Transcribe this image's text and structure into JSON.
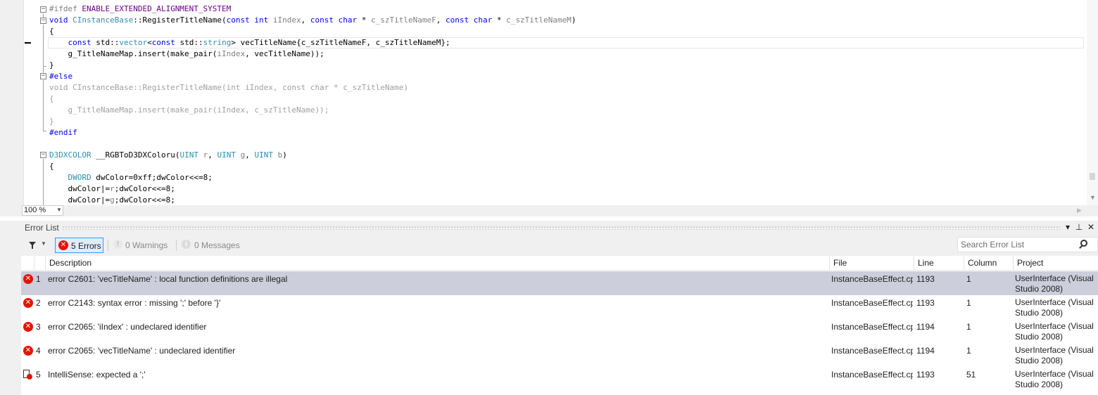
{
  "editor": {
    "code_lines": [
      [
        {
          "t": "#ifdef ",
          "c": "pp"
        },
        {
          "t": "ENABLE_EXTENDED_ALIGNMENT_SYSTEM",
          "c": "mc"
        }
      ],
      [
        {
          "t": "void ",
          "c": "kw"
        },
        {
          "t": "CInstanceBase",
          "c": "ty"
        },
        {
          "t": "::RegisterTitleName(",
          "c": "dk"
        },
        {
          "t": "const int ",
          "c": "kw"
        },
        {
          "t": "iIndex",
          "c": "pa"
        },
        {
          "t": ", ",
          "c": "dk"
        },
        {
          "t": "const char",
          "c": "kw"
        },
        {
          "t": " * ",
          "c": "dk"
        },
        {
          "t": "c_szTitleNameF",
          "c": "pa"
        },
        {
          "t": ", ",
          "c": "dk"
        },
        {
          "t": "const char",
          "c": "kw"
        },
        {
          "t": " * ",
          "c": "dk"
        },
        {
          "t": "c_szTitleNameM",
          "c": "pa"
        },
        {
          "t": ")",
          "c": "dk"
        }
      ],
      [
        {
          "t": "{",
          "c": "dk"
        }
      ],
      [
        {
          "t": "    ",
          "c": "dk"
        },
        {
          "t": "const ",
          "c": "kw"
        },
        {
          "t": "std::",
          "c": "dk"
        },
        {
          "t": "vector",
          "c": "ty"
        },
        {
          "t": "<",
          "c": "dk"
        },
        {
          "t": "const ",
          "c": "kw"
        },
        {
          "t": "std::",
          "c": "dk"
        },
        {
          "t": "string",
          "c": "ty"
        },
        {
          "t": "> vecTitleName{c_szTitleNameF, c_szTitleNameM};",
          "c": "dk"
        }
      ],
      [
        {
          "t": "    g_TitleNameMap.insert(make_pair(",
          "c": "dk"
        },
        {
          "t": "iIndex",
          "c": "pa"
        },
        {
          "t": ", vecTitleName));",
          "c": "dk"
        }
      ],
      [
        {
          "t": "}",
          "c": "dk"
        }
      ],
      [
        {
          "t": "#else",
          "c": "kw"
        }
      ],
      [
        {
          "t": "void CInstanceBase::RegisterTitleName(",
          "c": "gr"
        },
        {
          "t": "int",
          "c": "gr"
        },
        {
          "t": " iIndex, ",
          "c": "gr"
        },
        {
          "t": "const char",
          "c": "gr"
        },
        {
          "t": " * c_szTitleName)",
          "c": "gr"
        }
      ],
      [
        {
          "t": "{",
          "c": "gr"
        }
      ],
      [
        {
          "t": "    g_TitleNameMap.insert(make_pair(iIndex, c_szTitleName));",
          "c": "gr"
        }
      ],
      [
        {
          "t": "}",
          "c": "gr"
        }
      ],
      [
        {
          "t": "#endif",
          "c": "kw"
        }
      ],
      [
        {
          "t": "",
          "c": "dk"
        }
      ],
      [
        {
          "t": "D3DXCOLOR",
          "c": "ty"
        },
        {
          "t": " __RGBToD3DXColoru(",
          "c": "dk"
        },
        {
          "t": "UINT ",
          "c": "ty"
        },
        {
          "t": "r",
          "c": "pa"
        },
        {
          "t": ", ",
          "c": "dk"
        },
        {
          "t": "UINT ",
          "c": "ty"
        },
        {
          "t": "g",
          "c": "pa"
        },
        {
          "t": ", ",
          "c": "dk"
        },
        {
          "t": "UINT ",
          "c": "ty"
        },
        {
          "t": "b",
          "c": "pa"
        },
        {
          "t": ")",
          "c": "dk"
        }
      ],
      [
        {
          "t": "{",
          "c": "dk"
        }
      ],
      [
        {
          "t": "    ",
          "c": "dk"
        },
        {
          "t": "DWORD",
          "c": "ty"
        },
        {
          "t": " dwColor=0xff;dwColor<<=8;",
          "c": "dk"
        }
      ],
      [
        {
          "t": "    dwColor|=",
          "c": "dk"
        },
        {
          "t": "r",
          "c": "pa"
        },
        {
          "t": ";dwColor<<=8;",
          "c": "dk"
        }
      ],
      [
        {
          "t": "    dwColor|=",
          "c": "dk"
        },
        {
          "t": "g",
          "c": "pa"
        },
        {
          "t": ";dwColor<<=8;",
          "c": "dk"
        }
      ]
    ],
    "zoom_level": "100 %"
  },
  "error_list": {
    "title": "Error List",
    "title_buttons": {
      "dropdown": "▾",
      "pin": "⊥",
      "close": "✕"
    },
    "toolbar": {
      "errors_label": "5 Errors",
      "warnings_label": "0 Warnings",
      "messages_label": "0 Messages",
      "search_placeholder": "Search Error List"
    },
    "columns": {
      "description": "Description",
      "file": "File",
      "line": "Line",
      "column": "Column",
      "project": "Project"
    },
    "rows": [
      {
        "num": "1",
        "icon": "error-icon",
        "description": "error C2601: 'vecTitleName' : local function definitions are illegal",
        "file": "InstanceBaseEffect.cpp",
        "line": "1193",
        "column": "1",
        "project": "UserInterface (Visual Studio 2008)",
        "selected": true
      },
      {
        "num": "2",
        "icon": "error-icon",
        "description": "error C2143: syntax error : missing ';' before '}'",
        "file": "InstanceBaseEffect.cpp",
        "line": "1193",
        "column": "1",
        "project": "UserInterface (Visual Studio 2008)"
      },
      {
        "num": "3",
        "icon": "error-icon",
        "description": "error C2065: 'iIndex' : undeclared identifier",
        "file": "InstanceBaseEffect.cpp",
        "line": "1194",
        "column": "1",
        "project": "UserInterface (Visual Studio 2008)"
      },
      {
        "num": "4",
        "icon": "error-icon",
        "description": "error C2065: 'vecTitleName' : undeclared identifier",
        "file": "InstanceBaseEffect.cpp",
        "line": "1194",
        "column": "1",
        "project": "UserInterface (Visual Studio 2008)"
      },
      {
        "num": "5",
        "icon": "intellisense-error-icon",
        "description": "IntelliSense: expected a ';'",
        "file": "InstanceBaseEffect.cpp",
        "line": "1193",
        "column": "51",
        "project": "UserInterface (Visual Studio 2008)"
      }
    ]
  },
  "colors": {
    "selected_row": "#cccedb",
    "error_red": "#e51400",
    "keyword_blue": "#0000ff",
    "type_teal": "#2b91af"
  }
}
